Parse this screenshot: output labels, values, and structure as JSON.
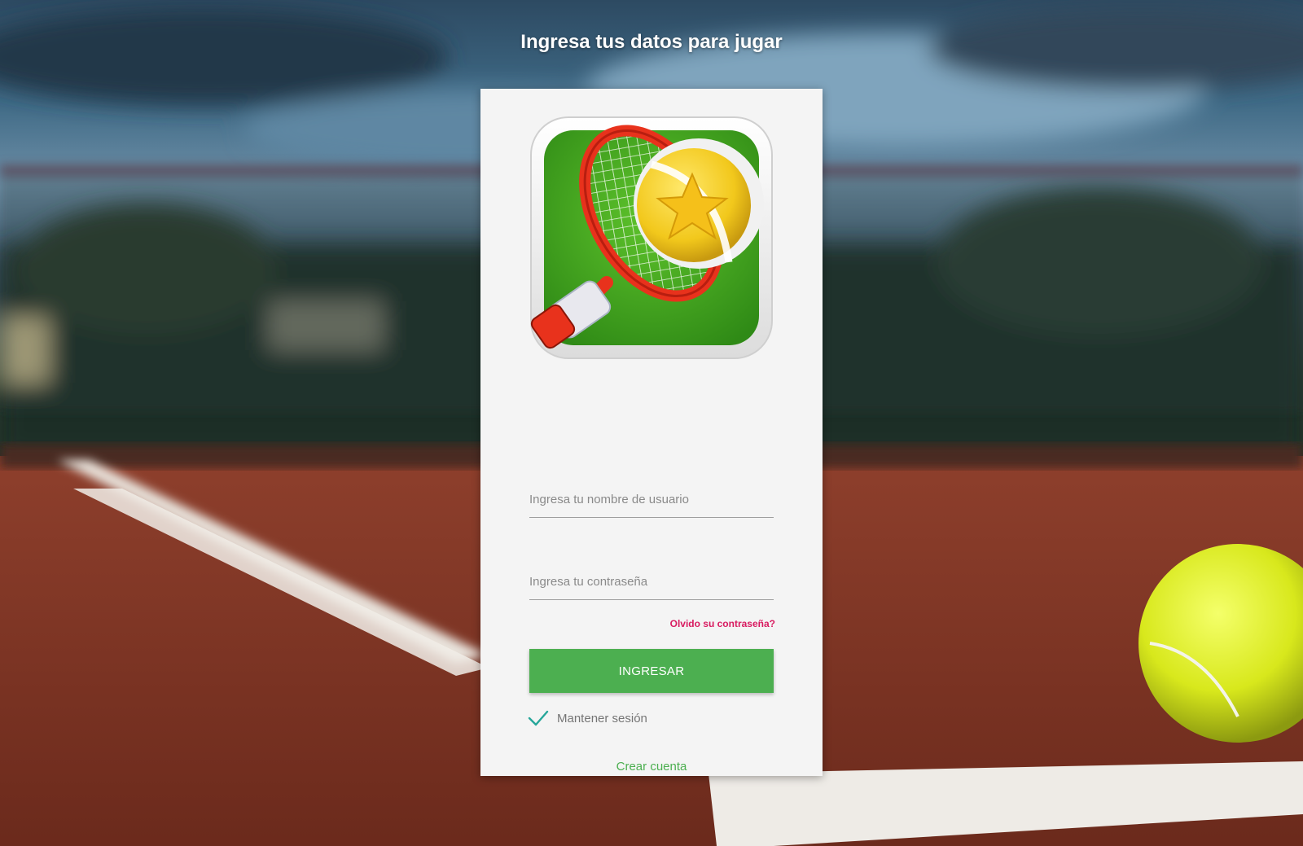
{
  "page": {
    "title": "Ingresa tus datos para jugar"
  },
  "login": {
    "logo_icon": "tennis-racket-ball-icon",
    "username": {
      "placeholder": "Ingresa tu nombre de usuario",
      "value": ""
    },
    "password": {
      "placeholder": "Ingresa tu contraseña",
      "value": ""
    },
    "forgot_label": "Olvido su contraseña?",
    "submit_label": "INGRESAR",
    "keep_session": {
      "label": "Mantener sesión",
      "checked": true,
      "icon": "check-icon"
    },
    "create_account_label": "Crear cuenta"
  },
  "colors": {
    "primary": "#4caf50",
    "forgot_link": "#d81b60",
    "card_bg": "#f4f4f4"
  }
}
